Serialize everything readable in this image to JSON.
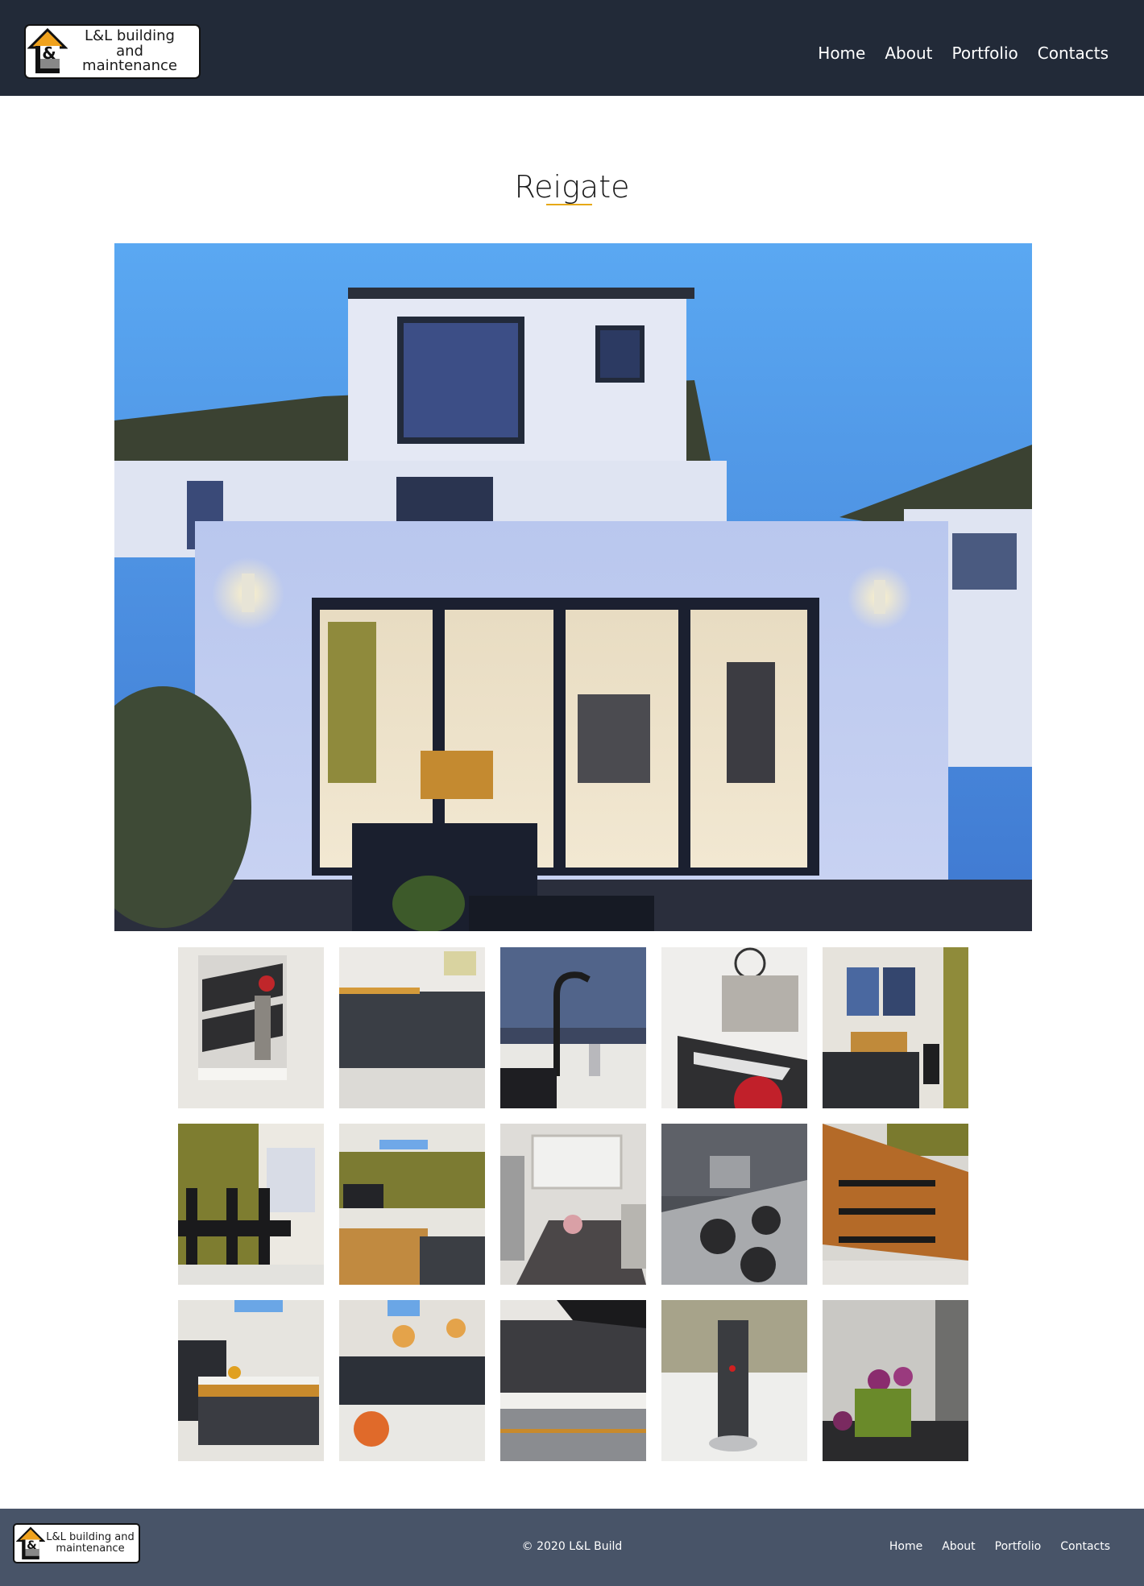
{
  "brand": {
    "name": "L&L building and maintenance",
    "logo_mark": "&",
    "accent": "#f0a21d"
  },
  "nav": {
    "items": [
      "Home",
      "About",
      "Portfolio",
      "Contacts"
    ]
  },
  "page": {
    "title": "Reigate",
    "title_accent": "#e6a817"
  },
  "hero": {
    "icon": "house-rear-extension-photo"
  },
  "gallery": {
    "count": 15,
    "items": [
      "hallway-storage-photo",
      "kitchen-units-photo",
      "kitchen-tap-photo",
      "wall-clock-photo",
      "living-room-photo",
      "dining-table-photo",
      "open-plan-lounge-photo",
      "bay-window-room-photo",
      "gas-hob-photo",
      "wood-sideboard-photo",
      "kitchen-island-photo",
      "kitchen-pendant-lights-photo",
      "kitchen-worktop-photo",
      "pop-up-socket-photo",
      "tulips-photo"
    ]
  },
  "footer": {
    "copyright": "© 2020 L&L Build",
    "nav": [
      "Home",
      "About",
      "Portfolio",
      "Contacts"
    ],
    "background": "#485468"
  },
  "colors": {
    "header_bg": "#222a38",
    "footer_bg": "#485468"
  }
}
